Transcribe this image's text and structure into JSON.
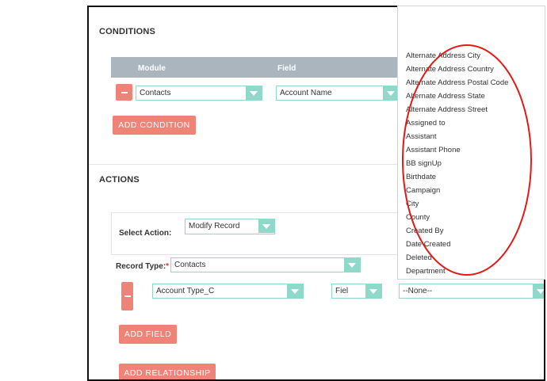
{
  "conditions": {
    "title": "CONDITIONS",
    "table_headers": {
      "module": "Module",
      "field": "Field"
    },
    "row": {
      "module_value": "Contacts",
      "field_value": "Account Name"
    },
    "add_condition_label": "ADD CONDITION"
  },
  "actions": {
    "title": "ACTIONS",
    "select_action_label": "Select Action:",
    "select_action_value": "Modify Record",
    "record_type_label": "Record Type:",
    "required_marker": "*",
    "record_type_value": "Contacts",
    "field_row": {
      "field_value": "Account Type_C",
      "type_value": "Fiel",
      "value_value": "--None--"
    },
    "add_field_label": "ADD FIELD",
    "add_relationship_label": "ADD RELATIONSHIP"
  },
  "field_dropdown": {
    "options": [
      "Alternate Address City",
      "Alternate Address Country",
      "Alternate Address Postal Code",
      "Alternate Address State",
      "Alternate Address Street",
      "Assigned to",
      "Assistant",
      "Assistant Phone",
      "BB signUp",
      "Birthdate",
      "Campaign",
      "City",
      "County",
      "Created By",
      "Date Created",
      "Deleted",
      "Department"
    ]
  },
  "colors": {
    "accent_button": "#f08377",
    "select_border": "#8fd9cb",
    "table_header": "#aab5bd",
    "annotation_oval": "#e31a1a"
  },
  "icons": {
    "remove": "minus-icon",
    "dropdown": "chevron-down-icon"
  }
}
